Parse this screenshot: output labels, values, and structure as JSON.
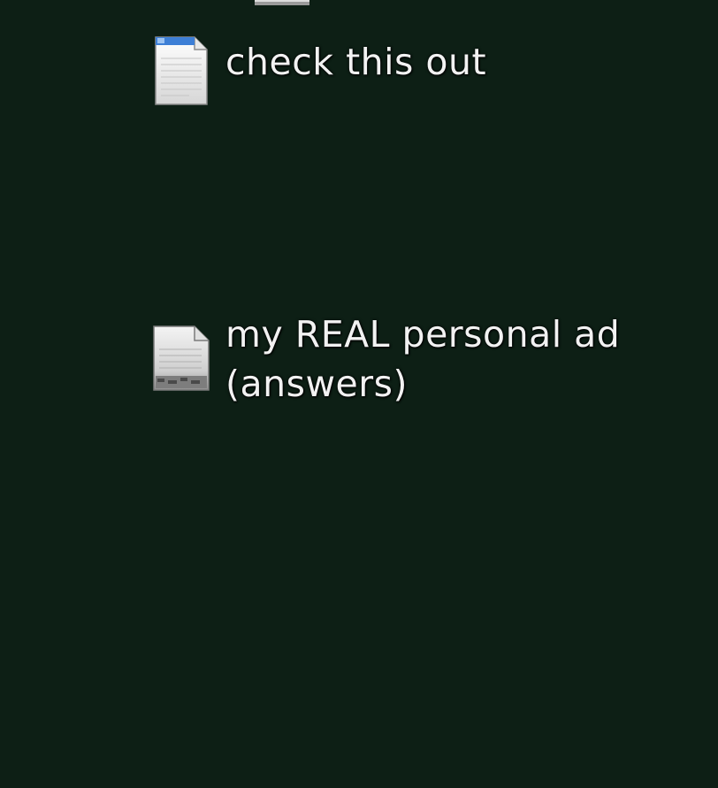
{
  "desktop": {
    "background_color": "#0d1f15",
    "partial_icon": {
      "icon": "document-icon"
    },
    "items": [
      {
        "label": "check this out",
        "icon": "text-document-icon"
      },
      {
        "label_line1": "my REAL personal ad",
        "label_line2": "(answers)",
        "icon": "plain-document-icon"
      }
    ]
  }
}
